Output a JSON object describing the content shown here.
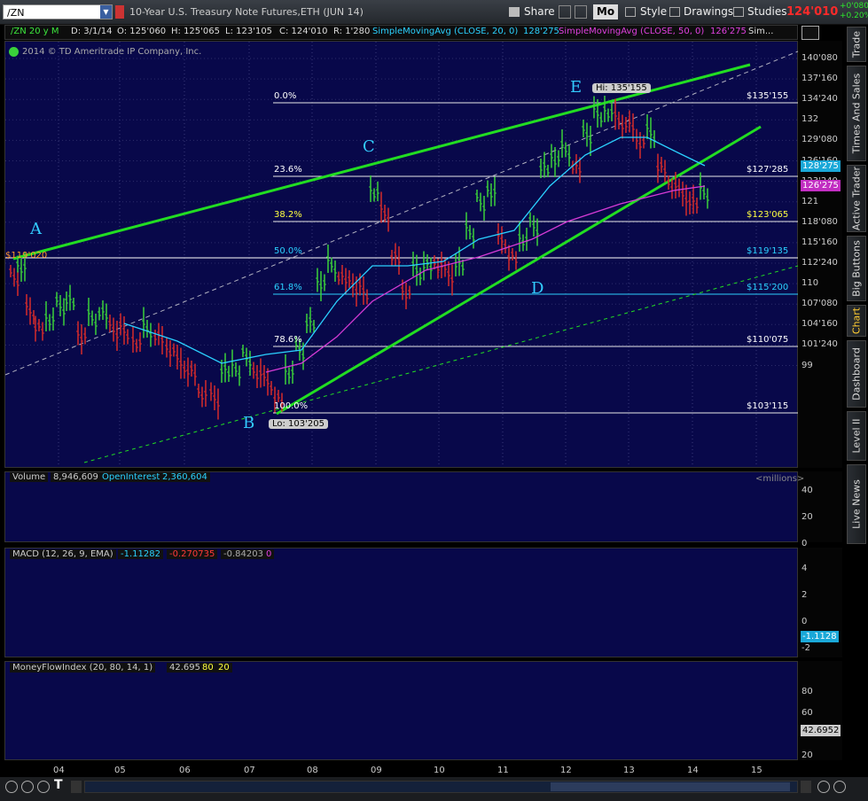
{
  "toolbar": {
    "symbol": "/ZN",
    "description": "10-Year U.S. Treasury Note Futures,ETH (JUN 14)",
    "share": "Share",
    "mo": "Mo",
    "style": "Style",
    "drawings": "Drawings",
    "studies": "Studies",
    "last_price": "124'010",
    "change_abs": "+0'080",
    "change_pct": "+0.20%"
  },
  "header": {
    "symbol_period": "/ZN 20 y M",
    "date": "D: 3/1/14",
    "open": "O: 125'060",
    "high": "H: 125'065",
    "low": "L: 123'105",
    "close": "C: 124'010",
    "range": "R: 1'280",
    "sma20": "SimpleMovingAvg (CLOSE, 20, 0)",
    "sma20_value": "128'275",
    "sma50": "SimpleMovingAvg (CLOSE, 50, 0)",
    "sma50_value": "126'275",
    "more": "Sim..."
  },
  "copyright": "2014 © TD Ameritrade IP Company, Inc.",
  "price_axis": [
    "140'080",
    "137'160",
    "134'240",
    "132",
    "129'080",
    "126'160",
    "123'240",
    "121",
    "118'080",
    "115'160",
    "112'240",
    "110",
    "107'080",
    "104'160",
    "101'240",
    "99"
  ],
  "price_tags": {
    "sma20": "128'275",
    "sma50": "126'275"
  },
  "x_axis": [
    "04",
    "05",
    "06",
    "07",
    "08",
    "09",
    "10",
    "11",
    "12",
    "13",
    "14",
    "15"
  ],
  "fib_levels": [
    {
      "pct": "0.0%",
      "price": "$135'155"
    },
    {
      "pct": "23.6%",
      "price": "$127'285"
    },
    {
      "pct": "38.2%",
      "price": "$123'065"
    },
    {
      "pct": "50.0%",
      "price": "$119'135"
    },
    {
      "pct": "61.8%",
      "price": "$115'200"
    },
    {
      "pct": "78.6%",
      "price": "$110'075"
    },
    {
      "pct": "100.0%",
      "price": "$103'115"
    }
  ],
  "labels": {
    "A": "A",
    "B": "B",
    "C": "C",
    "D": "D",
    "E": "E",
    "hi": "Hi: 135'155",
    "lo": "Lo: 103'205",
    "left_price": "$119'020"
  },
  "volume": {
    "label": "Volume",
    "value": "8,946,609",
    "oi_label": "OpenInterest",
    "oi_value": "2,360,604",
    "unit": "<millions>",
    "axis": [
      "40",
      "20",
      "0"
    ]
  },
  "macd": {
    "label": "MACD (12, 26, 9, EMA)",
    "v1": "-1.11282",
    "v2": "-0.270735",
    "v3": "-0.842032",
    "v4": "0",
    "axis": [
      "4",
      "2",
      "0",
      "-2"
    ],
    "tag": "-1.1128"
  },
  "mfi": {
    "label": "MoneyFlowIndex (20, 80, 14, 1)",
    "v1": "42.6952",
    "v2": "80",
    "v3": "20",
    "axis": [
      "80",
      "60",
      "40",
      "20"
    ],
    "tag": "42.6952"
  },
  "side_tabs": [
    "Trade",
    "Times And Sales",
    "Active Trader",
    "Big Buttons",
    "Chart",
    "Dashboard",
    "Level II",
    "Live News"
  ],
  "colors": {
    "sma20": "#2bd1ff",
    "sma50": "#d63bd6",
    "trend": "#22dd22",
    "up": "#3ad13a",
    "down": "#d62b2b",
    "fib": "#ffffff",
    "panel": "#08084a"
  }
}
